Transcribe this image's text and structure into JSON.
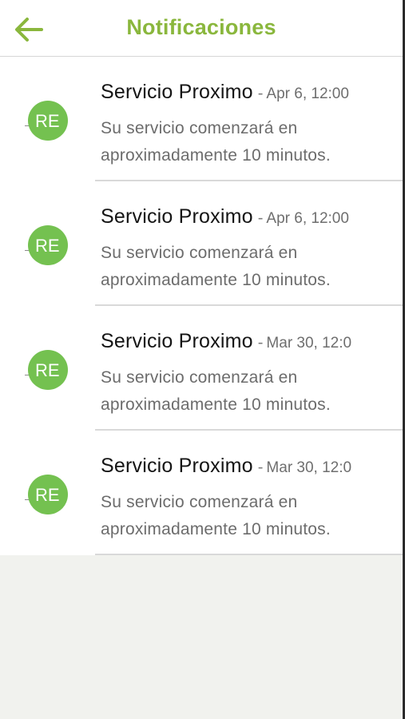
{
  "header": {
    "title": "Notificaciones",
    "back_icon": "arrow-left-icon"
  },
  "colors": {
    "accent": "#8ab73d",
    "avatar_bg": "#74c150",
    "background": "#f1f2ee"
  },
  "avatar_logo": "RE",
  "notifications": [
    {
      "title": "Servicio Proximo",
      "separator": "-",
      "time": "Apr 6, 12:00",
      "body": "Su servicio comenzará en aproximadamente 10 minutos."
    },
    {
      "title": "Servicio Proximo",
      "separator": "-",
      "time": "Apr 6, 12:00",
      "body": "Su servicio comenzará en aproximadamente 10 minutos."
    },
    {
      "title": "Servicio Proximo",
      "separator": "-",
      "time": "Mar 30, 12:0",
      "body": "Su servicio comenzará en aproximadamente 10 minutos."
    },
    {
      "title": "Servicio Proximo",
      "separator": "-",
      "time": "Mar 30, 12:0",
      "body": "Su servicio comenzará en aproximadamente 10 minutos."
    }
  ]
}
